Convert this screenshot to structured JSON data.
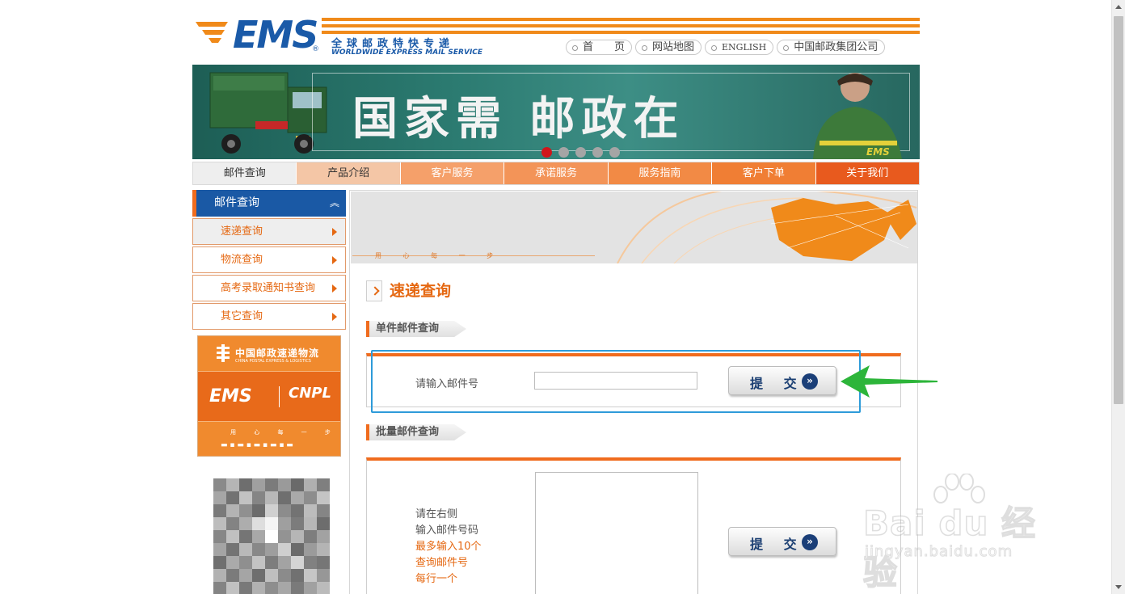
{
  "logo": {
    "ems": "EMS",
    "reg": "®",
    "cn_name": "全球邮政特快专递",
    "en_name": "WORLDWIDE EXPRESS MAIL SERVICE"
  },
  "top_links": [
    "首　　页",
    "网站地图",
    "ENGLISH",
    "中国邮政集团公司"
  ],
  "banner": {
    "slogan": "国家需 邮政在",
    "slide_count": 5,
    "active_slide": 1,
    "man_logo": "EMS"
  },
  "nav": {
    "items": [
      {
        "label": "邮件查询",
        "color": "#eeeeee",
        "text_color": "#333333"
      },
      {
        "label": "产品介绍",
        "color": "#f4c6a6",
        "text_color": "#333333"
      },
      {
        "label": "客户服务",
        "color": "#f5a06a"
      },
      {
        "label": "承诺服务",
        "color": "#f39458"
      },
      {
        "label": "服务指南",
        "color": "#f28a45"
      },
      {
        "label": "客户下单",
        "color": "#f07e34"
      },
      {
        "label": "关于我们",
        "color": "#e85a1e"
      }
    ]
  },
  "sidebar": {
    "header": "邮件查询",
    "items": [
      "速递查询",
      "物流查询",
      "高考录取通知书查询",
      "其它查询"
    ],
    "active_index": 0
  },
  "promo": {
    "cn_title": "中国邮政速递物流",
    "en_title": "CHINA POSTAL EXPRESS & LOGISTICS",
    "ems": "EMS",
    "cnpl": "CNPL",
    "slogan": "用 心 每 一 步"
  },
  "main": {
    "banner_slogan": "用 心 每 一 步",
    "page_title": "速递查询",
    "single": {
      "tab": "单件邮件查询",
      "prompt": "请输入邮件号",
      "value": "",
      "submit": "提 交",
      "submit_icon": "»"
    },
    "batch": {
      "tab": "批量邮件查询",
      "lines_gray": [
        "请在右侧",
        "输入邮件号码"
      ],
      "lines_orange": [
        "最多输入10个",
        "查询邮件号",
        "每行一个"
      ],
      "value": "",
      "submit": "提 交",
      "submit_icon": "»"
    }
  },
  "watermark": {
    "brand": "Bai du 经验",
    "url": "jingyan.baidu.com"
  },
  "colors": {
    "ems_blue": "#1a5aa8",
    "accent_orange": "#f06c1e",
    "highlight_blue": "#2e9bd9",
    "arrow_green": "#2db53a"
  }
}
